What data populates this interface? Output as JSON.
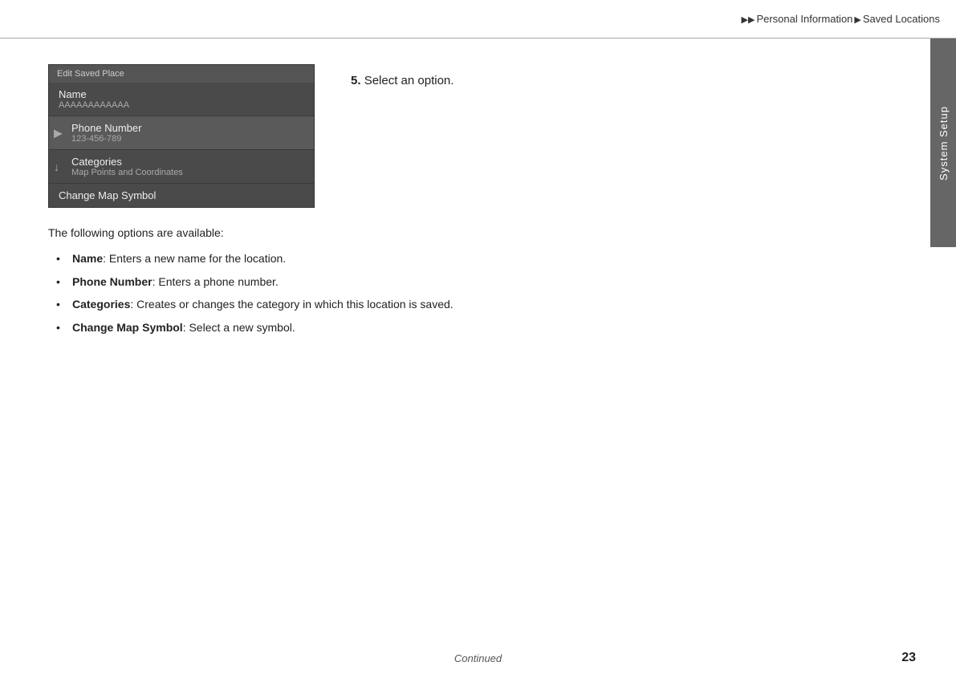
{
  "breadcrumb": {
    "arrow1": "▶▶",
    "section1": "Personal Information",
    "arrow2": "▶",
    "section2": "Saved Locations"
  },
  "side_tab": {
    "label": "System Setup"
  },
  "ui_mockup": {
    "titlebar": "Edit Saved Place",
    "menu_items": [
      {
        "id": "name",
        "main": "Name",
        "sub": "AAAAAAAAAAAA",
        "icon": "",
        "highlighted": false
      },
      {
        "id": "phone_number",
        "main": "Phone Number",
        "sub": "123-456-789",
        "icon": "▶",
        "highlighted": true
      },
      {
        "id": "categories",
        "main": "Categories",
        "sub": "Map Points and Coordinates",
        "icon": "↓",
        "highlighted": false
      },
      {
        "id": "change_map_symbol",
        "main": "Change Map Symbol",
        "sub": "",
        "icon": "",
        "highlighted": false
      }
    ]
  },
  "instruction": {
    "step_number": "5.",
    "text": "Select an option."
  },
  "description": {
    "intro": "The following options are available:",
    "bullets": [
      {
        "term": "Name",
        "desc": ": Enters a new name for the location."
      },
      {
        "term": "Phone Number",
        "desc": ": Enters a phone number."
      },
      {
        "term": "Categories",
        "desc": ": Creates or changes the category in which this location is saved."
      },
      {
        "term": "Change Map Symbol",
        "desc": ": Select a new symbol."
      }
    ]
  },
  "footer": {
    "continued_label": "Continued",
    "page_number": "23"
  }
}
